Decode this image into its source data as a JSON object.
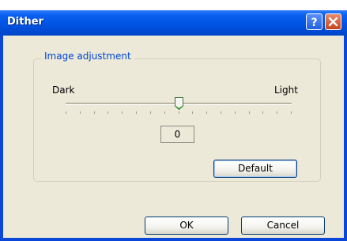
{
  "window": {
    "title": "Dither"
  },
  "titlebar_buttons": {
    "help_icon": "question-mark",
    "close_icon": "x-mark"
  },
  "group": {
    "label": "Image adjustment",
    "slider": {
      "min_label": "Dark",
      "max_label": "Light",
      "tick_count": 17,
      "level_fraction": 0.5
    },
    "value": "0",
    "default_button": "Default"
  },
  "footer": {
    "ok_button": "OK",
    "cancel_button": "Cancel"
  },
  "colors": {
    "titlebar": "#0054e3",
    "dialog_face": "#ece9d8",
    "group_label": "#0046d5"
  }
}
